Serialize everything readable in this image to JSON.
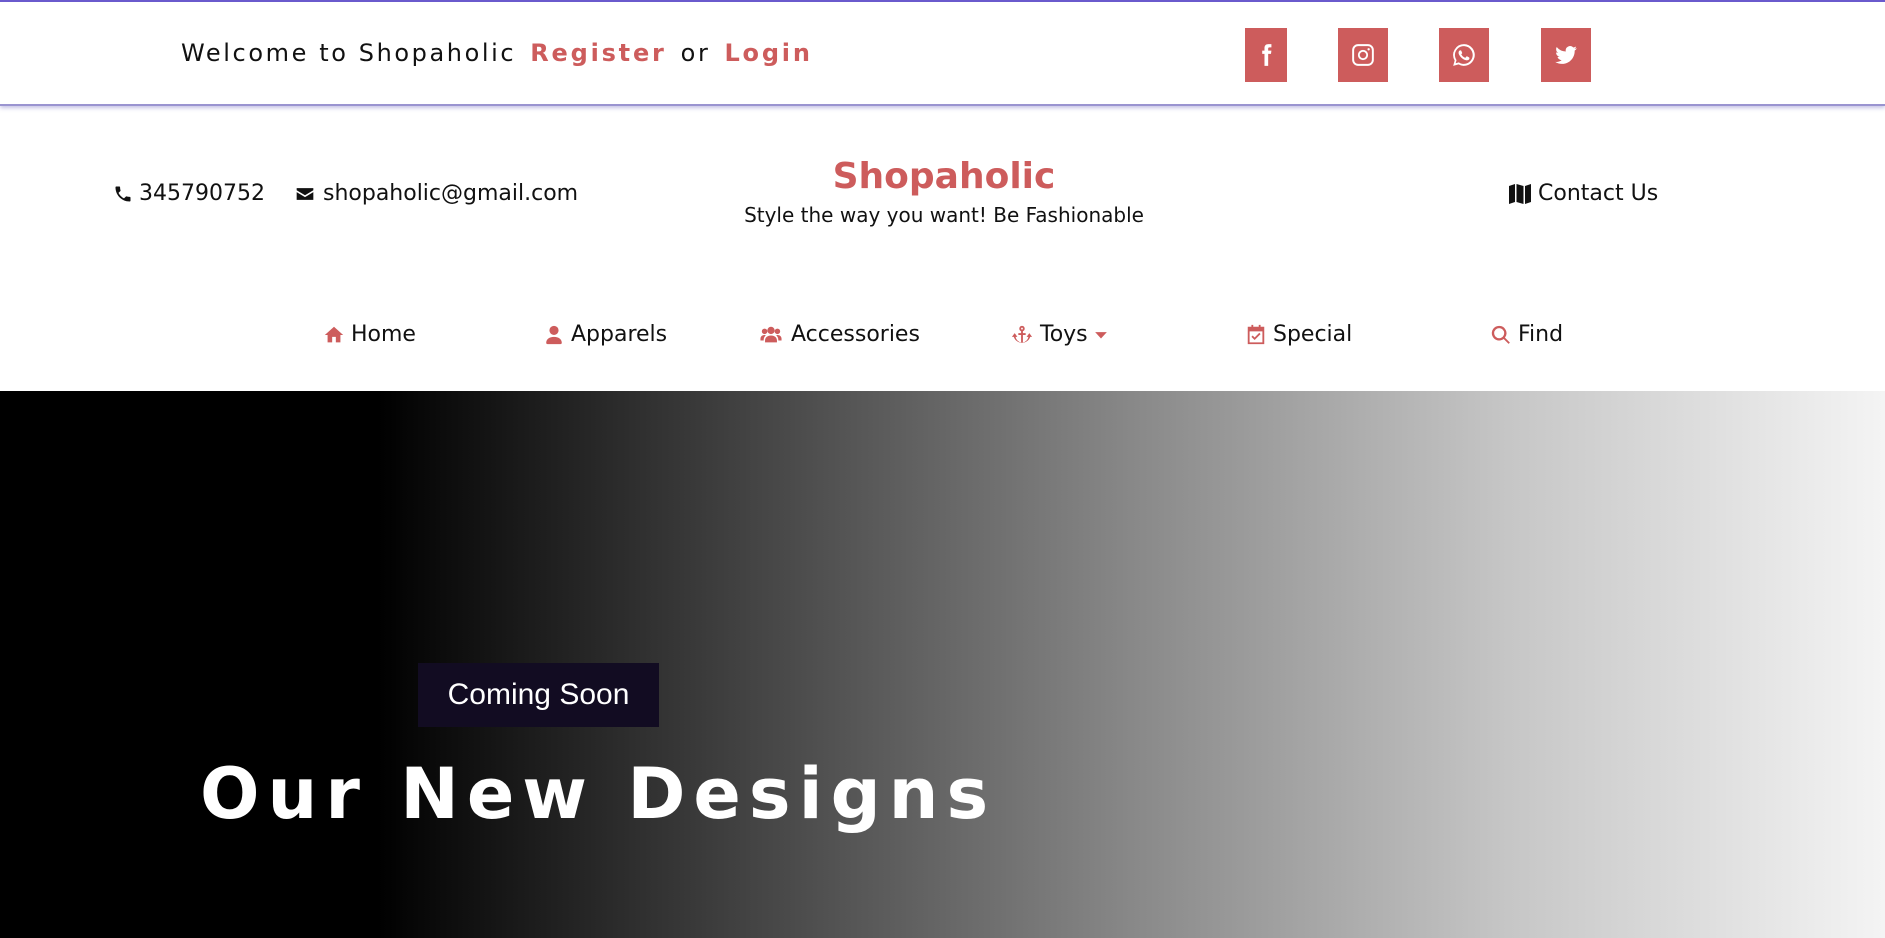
{
  "topbar": {
    "welcome_text": "Welcome to Shopaholic",
    "register_label": "Register",
    "or_text": "or",
    "login_label": "Login",
    "social": [
      "facebook-icon",
      "instagram-icon",
      "whatsapp-icon",
      "twitter-icon"
    ]
  },
  "header": {
    "phone": "345790752",
    "email": "shopaholic@gmail.com",
    "brand_name": "Shopaholic",
    "tagline": "Style the way you want! Be Fashionable",
    "contact_label": "Contact Us"
  },
  "nav": {
    "items": [
      {
        "label": "Home",
        "icon": "home-icon"
      },
      {
        "label": "Apparels",
        "icon": "user-icon"
      },
      {
        "label": "Accessories",
        "icon": "users-icon"
      },
      {
        "label": "Toys",
        "icon": "anchor-icon"
      },
      {
        "label": "Special",
        "icon": "calendar-check-icon"
      },
      {
        "label": "Find",
        "icon": "search-icon"
      }
    ]
  },
  "hero": {
    "badge": "Coming Soon",
    "title": "Our New Designs"
  },
  "colors": {
    "accent": "#cd5c5c",
    "topbar_border": "#6a5acd",
    "badge_bg": "#120c22"
  }
}
